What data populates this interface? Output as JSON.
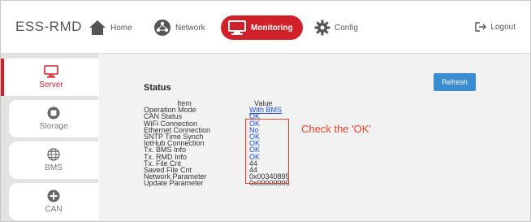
{
  "header": {
    "brand": "ESS-RMD",
    "nav": [
      {
        "label": "Home",
        "icon": "home-icon"
      },
      {
        "label": "Network",
        "icon": "network-icon"
      },
      {
        "label": "Monitoring",
        "icon": "monitor-icon"
      },
      {
        "label": "Config",
        "icon": "gear-icon"
      }
    ],
    "logout_label": "Logout",
    "accent_color": "#d0212a"
  },
  "sidebar": {
    "items": [
      {
        "label": "Server",
        "icon": "monitor-icon",
        "active": true
      },
      {
        "label": "Storage",
        "icon": "storage-icon"
      },
      {
        "label": "BMS",
        "icon": "globe-icon"
      },
      {
        "label": "CAN",
        "icon": "plus-circle-icon"
      }
    ]
  },
  "main": {
    "title": "Status",
    "refresh_label": "Refresh",
    "table": {
      "headers": [
        "Item",
        "Value"
      ],
      "rows": [
        [
          "Operation Mode",
          "With BMS"
        ],
        [
          "CAN Status",
          "OK"
        ],
        [
          "WiFi Connection",
          "OK"
        ],
        [
          "Ethernet Connection",
          "No"
        ],
        [
          "SNTP Time Synch",
          "OK"
        ],
        [
          "IotHub Connection",
          "OK"
        ],
        [
          "Tx. BMS Info",
          "OK"
        ],
        [
          "Tx. RMD Info",
          "OK"
        ],
        [
          "Tx. File Cnt",
          "44"
        ],
        [
          "Saved File Cnt",
          "44"
        ],
        [
          "Network Parameter",
          "0x00340895"
        ],
        [
          "Update Parameter",
          "0x00000000"
        ]
      ]
    },
    "annotation": "Check the 'OK'"
  }
}
